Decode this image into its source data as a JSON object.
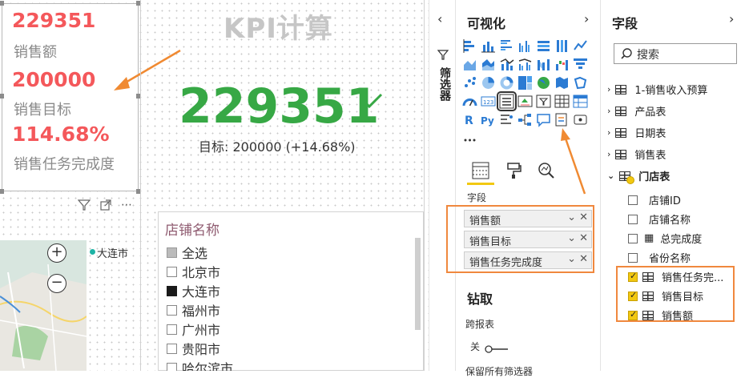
{
  "card": {
    "value1": "229351",
    "label1": "销售额",
    "value2": "200000",
    "label2": "销售目标",
    "value3": "114.68%",
    "label3": "销售任务完成度"
  },
  "kpi": {
    "title": "KPI计算",
    "value": "229351",
    "goal_text": "目标: 200000 (+14.68%)"
  },
  "map": {
    "city_label": "大连市"
  },
  "slicer": {
    "title": "店铺名称",
    "items": [
      {
        "label": "全选",
        "state": "partial"
      },
      {
        "label": "北京市",
        "state": "off"
      },
      {
        "label": "大连市",
        "state": "on"
      },
      {
        "label": "福州市",
        "state": "off"
      },
      {
        "label": "广州市",
        "state": "off"
      },
      {
        "label": "贵阳市",
        "state": "off"
      },
      {
        "label": "哈尔滨市",
        "state": "off"
      }
    ]
  },
  "filter_pane": {
    "label": "筛选器"
  },
  "viz_pane": {
    "title": "可视化",
    "fields_label": "字段",
    "wells": [
      "销售额",
      "销售目标",
      "销售任务完成度"
    ],
    "drill_title": "钻取",
    "cross_report_label": "跨报表",
    "toggle_label": "关",
    "cut_off_label": "保留所有筛选器"
  },
  "fields_pane": {
    "title": "字段",
    "search_placeholder": "搜索",
    "tables": [
      {
        "label": "1-销售收入预算",
        "expanded": false
      },
      {
        "label": "产品表",
        "expanded": false
      },
      {
        "label": "日期表",
        "expanded": false
      },
      {
        "label": "销售表",
        "expanded": false
      },
      {
        "label": "门店表",
        "expanded": true
      }
    ],
    "fields": [
      {
        "label": "店铺ID",
        "checked": false,
        "icon": "none"
      },
      {
        "label": "店铺名称",
        "checked": false,
        "icon": "none"
      },
      {
        "label": "总完成度",
        "checked": false,
        "icon": "calculator-icon"
      },
      {
        "label": "省份名称",
        "checked": false,
        "icon": "none"
      },
      {
        "label": "销售任务完...",
        "checked": true,
        "icon": "measure-table-icon"
      },
      {
        "label": "销售目标",
        "checked": true,
        "icon": "measure-table-icon"
      },
      {
        "label": "销售额",
        "checked": true,
        "icon": "measure-table-icon"
      }
    ]
  },
  "colors": {
    "card_red": "#f4585b",
    "kpi_green": "#37a845",
    "highlight_orange": "#f0883e",
    "arrow_orange": "#f08a32"
  }
}
